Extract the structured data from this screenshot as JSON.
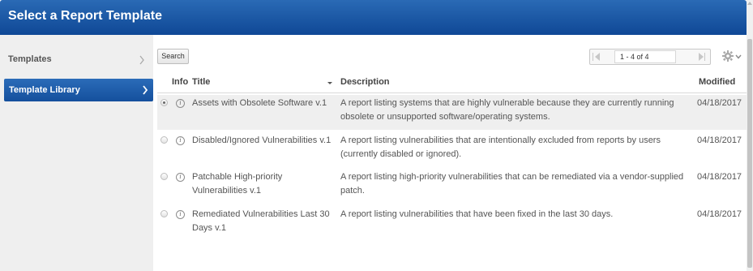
{
  "header": {
    "title": "Select a Report Template"
  },
  "sidebar": {
    "items": [
      {
        "label": "Templates"
      },
      {
        "label": "Template Library"
      }
    ]
  },
  "toolbar": {
    "search_label": "Search",
    "pager_text": "1 - 4 of 4"
  },
  "table": {
    "columns": {
      "info": "Info",
      "title": "Title",
      "description": "Description",
      "modified": "Modified"
    },
    "rows": [
      {
        "title": "Assets with Obsolete Software v.1",
        "description": "A report listing systems that are highly vulnerable because they are currently running obsolete or unsupported software/operating systems.",
        "modified": "04/18/2017"
      },
      {
        "title": "Disabled/Ignored Vulnerabilities v.1",
        "description": "A report listing vulnerabilities that are intentionally excluded from reports by users (currently disabled or ignored).",
        "modified": "04/18/2017"
      },
      {
        "title": "Patchable High-priority Vulnerabilities v.1",
        "description": "A report listing high-priority vulnerabilities that can be remediated via a vendor-supplied patch.",
        "modified": "04/18/2017"
      },
      {
        "title": "Remediated Vulnerabilities Last 30 Days v.1",
        "description": "A report listing vulnerabilities that have been fixed in the last 30 days.",
        "modified": "04/18/2017"
      }
    ]
  },
  "icons": {
    "info": "info-icon",
    "settings": "gear-icon",
    "chevron": "chevron-right-icon",
    "pager_prev": "first-page-icon",
    "pager_next": "last-page-icon"
  },
  "colors": {
    "header": "#1a56a3",
    "selected_nav": "#1f5eae",
    "selected_row": "#efefef",
    "sidebar_bg": "#efefef"
  }
}
